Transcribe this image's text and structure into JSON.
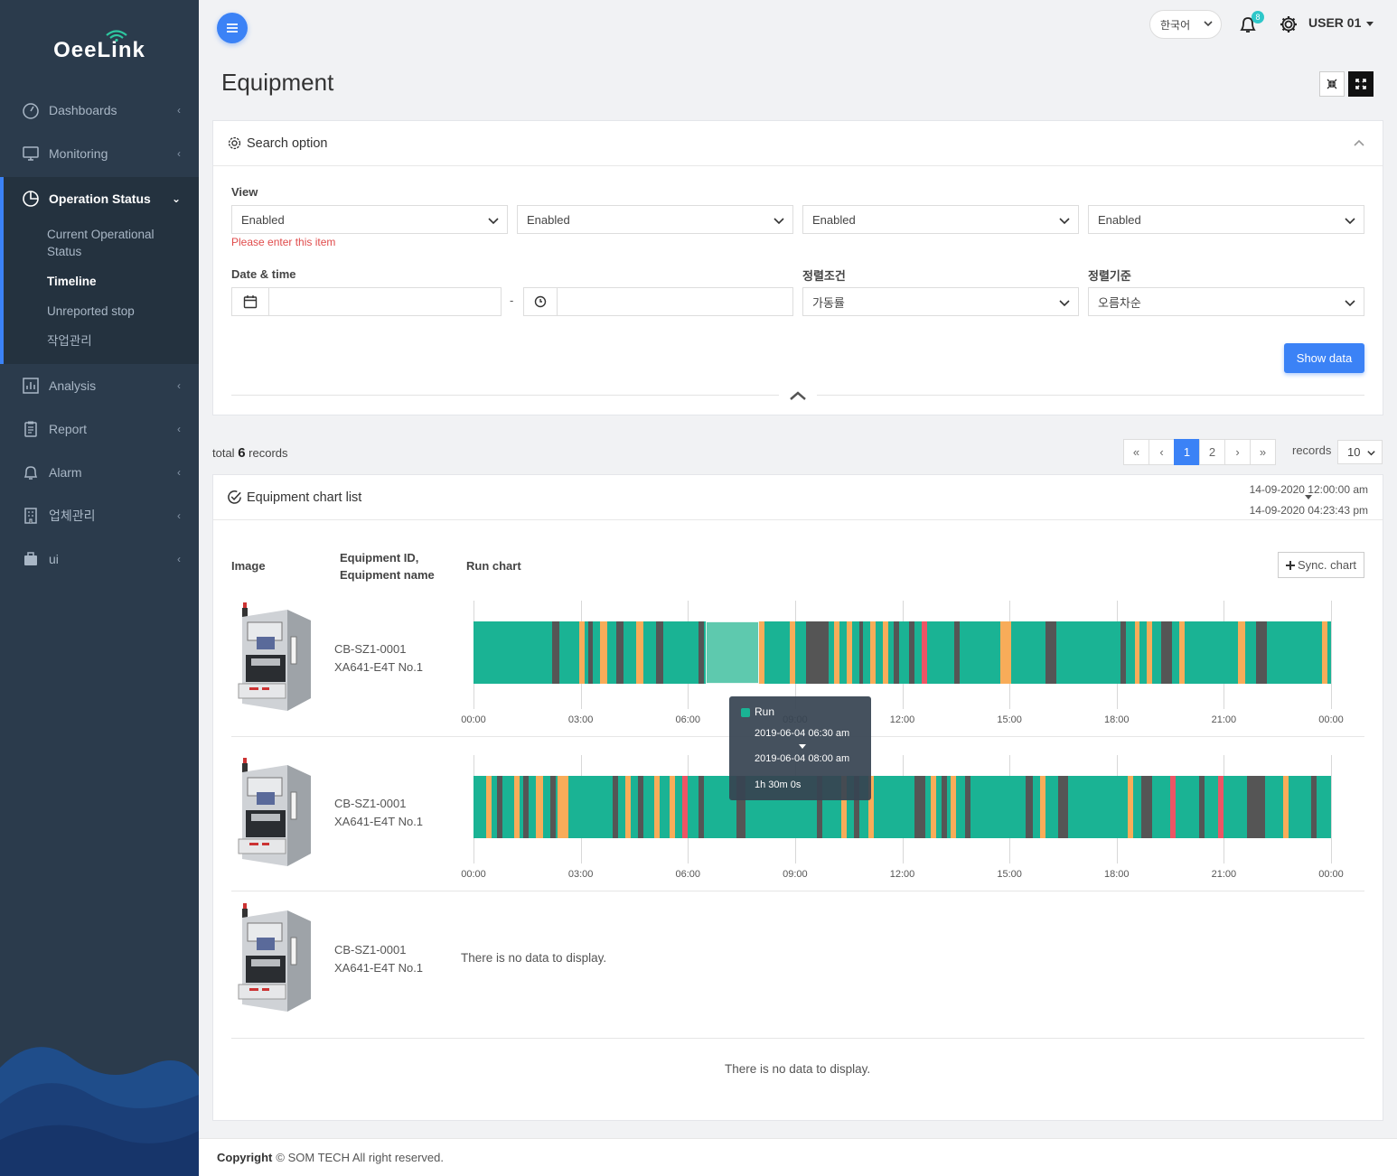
{
  "brand": {
    "name": "OeeLink"
  },
  "sidebar": {
    "items": [
      {
        "label": "Dashboards"
      },
      {
        "label": "Monitoring"
      },
      {
        "label": "Operation Status"
      },
      {
        "label": "Analysis"
      },
      {
        "label": "Report"
      },
      {
        "label": "Alarm"
      },
      {
        "label": "업체관리"
      },
      {
        "label": "ui"
      }
    ],
    "subitems": [
      "Current Operational Status",
      "Timeline",
      "Unreported stop",
      "작업관리"
    ]
  },
  "topbar": {
    "language": "한국어",
    "notifications": "8",
    "user": "USER 01"
  },
  "page": {
    "title": "Equipment"
  },
  "search": {
    "title": "Search option",
    "view_label": "View",
    "view_values": [
      "Enabled",
      "Enabled",
      "Enabled",
      "Enabled"
    ],
    "error": "Please enter this item",
    "datetime_label": "Date & time",
    "separator": "-",
    "sort_cond_label": "정렬조건",
    "sort_cond_value": "가동률",
    "sort_order_label": "정렬기준",
    "sort_order_value": "오름차순",
    "show_button": "Show data"
  },
  "list": {
    "total_prefix": "total",
    "total_count": "6",
    "total_suffix": "records",
    "pages": [
      "«",
      "‹",
      "1",
      "2",
      "›",
      "»"
    ],
    "current_page": "1",
    "records_label": "records",
    "records_value": "10"
  },
  "chart_card": {
    "title": "Equipment chart list",
    "range_start": "14-09-2020 12:00:00 am",
    "range_end": "14-09-2020 04:23:43 pm",
    "col_image": "Image",
    "col_equipment": "Equipment ID, Equipment name",
    "col_chart": "Run chart",
    "sync_button": "Sync. chart",
    "rows": [
      {
        "id": "CB-SZ1-0001",
        "name": "XA641-E4T No.1"
      },
      {
        "id": "CB-SZ1-0001",
        "name": "XA641-E4T No.1"
      },
      {
        "id": "CB-SZ1-0001",
        "name": "XA641-E4T No.1",
        "message": "There is no data to display."
      }
    ],
    "bottom_message": "There is no data to display.",
    "tooltip": {
      "status": "Run",
      "start": "2019-06-04 06:30 am",
      "end": "2019-06-04 08:00 am",
      "duration": "1h 30m 0s"
    }
  },
  "chart_data": {
    "type": "timeline",
    "x_ticks": [
      "00:00",
      "03:00",
      "06:00",
      "09:00",
      "12:00",
      "15:00",
      "18:00",
      "21:00",
      "00:00"
    ],
    "xlim_hours": [
      0,
      24
    ],
    "status_colors": {
      "run": "#1ab394",
      "idle": "#f8ac59",
      "stop": "#555555",
      "alarm": "#ed5565"
    },
    "series": [
      {
        "segments": [
          {
            "s": 2.2,
            "e": 2.4,
            "t": "stop"
          },
          {
            "s": 2.95,
            "e": 3.1,
            "t": "idle"
          },
          {
            "s": 3.2,
            "e": 3.35,
            "t": "stop"
          },
          {
            "s": 3.55,
            "e": 3.75,
            "t": "idle"
          },
          {
            "s": 4.0,
            "e": 4.2,
            "t": "stop"
          },
          {
            "s": 4.55,
            "e": 4.75,
            "t": "idle"
          },
          {
            "s": 5.1,
            "e": 5.3,
            "t": "stop"
          },
          {
            "s": 6.3,
            "e": 6.45,
            "t": "stop"
          },
          {
            "s": 8.0,
            "e": 8.15,
            "t": "idle"
          },
          {
            "s": 8.85,
            "e": 9.0,
            "t": "idle"
          },
          {
            "s": 9.3,
            "e": 9.95,
            "t": "stop"
          },
          {
            "s": 10.1,
            "e": 10.25,
            "t": "idle"
          },
          {
            "s": 10.45,
            "e": 10.6,
            "t": "idle"
          },
          {
            "s": 10.8,
            "e": 10.9,
            "t": "stop"
          },
          {
            "s": 11.1,
            "e": 11.25,
            "t": "idle"
          },
          {
            "s": 11.45,
            "e": 11.6,
            "t": "idle"
          },
          {
            "s": 11.75,
            "e": 11.9,
            "t": "stop"
          },
          {
            "s": 12.2,
            "e": 12.35,
            "t": "stop"
          },
          {
            "s": 12.55,
            "e": 12.7,
            "t": "alarm"
          },
          {
            "s": 13.45,
            "e": 13.6,
            "t": "stop"
          },
          {
            "s": 14.75,
            "e": 15.05,
            "t": "idle"
          },
          {
            "s": 16.0,
            "e": 16.3,
            "t": "stop"
          },
          {
            "s": 18.1,
            "e": 18.25,
            "t": "stop"
          },
          {
            "s": 18.5,
            "e": 18.65,
            "t": "idle"
          },
          {
            "s": 18.85,
            "e": 19.0,
            "t": "idle"
          },
          {
            "s": 19.25,
            "e": 19.55,
            "t": "stop"
          },
          {
            "s": 19.75,
            "e": 19.9,
            "t": "idle"
          },
          {
            "s": 21.4,
            "e": 21.6,
            "t": "idle"
          },
          {
            "s": 21.9,
            "e": 22.2,
            "t": "stop"
          },
          {
            "s": 23.75,
            "e": 23.9,
            "t": "idle"
          }
        ],
        "highlight": {
          "s": 6.5,
          "e": 8.0
        }
      },
      {
        "segments": [
          {
            "s": 0.35,
            "e": 0.5,
            "t": "idle"
          },
          {
            "s": 0.65,
            "e": 0.8,
            "t": "stop"
          },
          {
            "s": 1.15,
            "e": 1.3,
            "t": "idle"
          },
          {
            "s": 1.4,
            "e": 1.55,
            "t": "stop"
          },
          {
            "s": 1.75,
            "e": 1.95,
            "t": "idle"
          },
          {
            "s": 2.15,
            "e": 2.3,
            "t": "stop"
          },
          {
            "s": 2.35,
            "e": 2.65,
            "t": "idle"
          },
          {
            "s": 3.9,
            "e": 4.05,
            "t": "stop"
          },
          {
            "s": 4.25,
            "e": 4.4,
            "t": "idle"
          },
          {
            "s": 4.6,
            "e": 4.75,
            "t": "stop"
          },
          {
            "s": 5.05,
            "e": 5.2,
            "t": "idle"
          },
          {
            "s": 5.5,
            "e": 5.65,
            "t": "idle"
          },
          {
            "s": 5.85,
            "e": 6.0,
            "t": "alarm"
          },
          {
            "s": 6.3,
            "e": 6.45,
            "t": "stop"
          },
          {
            "s": 7.35,
            "e": 7.6,
            "t": "stop"
          },
          {
            "s": 9.6,
            "e": 9.75,
            "t": "stop"
          },
          {
            "s": 10.3,
            "e": 10.45,
            "t": "idle"
          },
          {
            "s": 10.65,
            "e": 10.8,
            "t": "stop"
          },
          {
            "s": 11.05,
            "e": 11.2,
            "t": "idle"
          },
          {
            "s": 12.35,
            "e": 12.65,
            "t": "stop"
          },
          {
            "s": 12.8,
            "e": 12.95,
            "t": "idle"
          },
          {
            "s": 13.1,
            "e": 13.25,
            "t": "stop"
          },
          {
            "s": 13.35,
            "e": 13.5,
            "t": "idle"
          },
          {
            "s": 13.75,
            "e": 13.9,
            "t": "stop"
          },
          {
            "s": 15.45,
            "e": 15.65,
            "t": "stop"
          },
          {
            "s": 15.85,
            "e": 16.0,
            "t": "idle"
          },
          {
            "s": 16.35,
            "e": 16.65,
            "t": "stop"
          },
          {
            "s": 18.3,
            "e": 18.45,
            "t": "idle"
          },
          {
            "s": 18.7,
            "e": 19.0,
            "t": "stop"
          },
          {
            "s": 19.5,
            "e": 19.65,
            "t": "alarm"
          },
          {
            "s": 20.3,
            "e": 20.45,
            "t": "stop"
          },
          {
            "s": 20.85,
            "e": 21.0,
            "t": "alarm"
          },
          {
            "s": 21.65,
            "e": 22.15,
            "t": "stop"
          },
          {
            "s": 22.65,
            "e": 22.8,
            "t": "idle"
          },
          {
            "s": 23.45,
            "e": 23.6,
            "t": "stop"
          }
        ]
      }
    ]
  },
  "footer": {
    "copyright_label": "Copyright",
    "text": "© SOM TECH All right reserved."
  }
}
